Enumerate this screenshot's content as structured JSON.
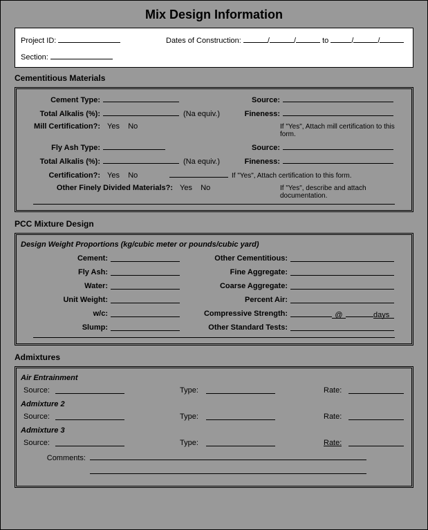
{
  "title": "Mix Design Information",
  "header": {
    "project_id_label": "Project ID:",
    "dates_label": "Dates of Construction:",
    "dates_sep": "to",
    "section_label": "Section:"
  },
  "sections": {
    "cementitious": {
      "heading": "Cementitious Materials",
      "cement_type": "Cement Type:",
      "source": "Source:",
      "total_alkalis": "Total Alkalis (%):",
      "na_equiv": "(Na equiv.)",
      "fineness": "Fineness:",
      "mill_cert": "Mill Certification?:",
      "yes": "Yes",
      "no": "No",
      "mill_note": "If \"Yes\", Attach mill certification to this form.",
      "fly_ash_type": "Fly Ash Type:",
      "certification": "Certification?:",
      "cert_note": "If \"Yes\", Attach certification to this form.",
      "other_finely": "Other Finely Divided Materials?:",
      "other_note": "If \"Yes\", describe and attach documentation."
    },
    "pcc": {
      "heading": "PCC Mixture Design",
      "subhead": "Design Weight Proportions (kg/cubic meter or pounds/cubic yard)",
      "cement": "Cement:",
      "other_cem": "Other Cementitious:",
      "fly_ash": "Fly Ash:",
      "fine_agg": "Fine Aggregate:",
      "water": "Water:",
      "coarse_agg": "Coarse Aggregate:",
      "unit_weight": "Unit Weight:",
      "percent_air": "Percent Air:",
      "wc": "w/c:",
      "comp_strength": "Compressive Strength:",
      "at": "@",
      "days": "days",
      "slump": "Slump:",
      "other_tests": "Other Standard Tests:"
    },
    "admixtures": {
      "heading": "Admixtures",
      "air_ent": "Air Entrainment",
      "source": "Source:",
      "type": "Type:",
      "rate": "Rate:",
      "adm2": "Admixture 2",
      "adm3": "Admixture 3",
      "comments": "Comments:"
    }
  }
}
